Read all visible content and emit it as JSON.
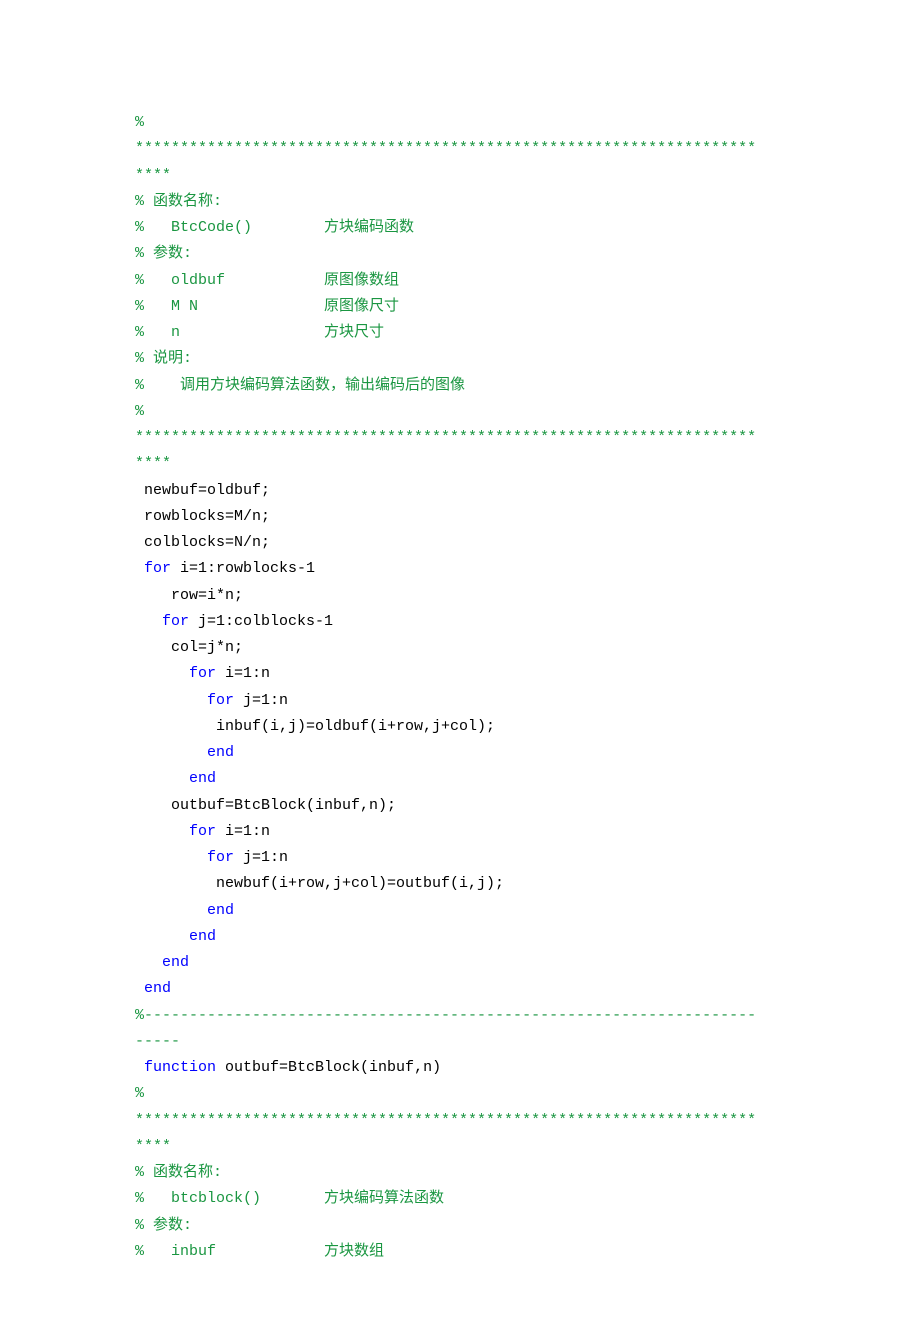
{
  "lines": [
    [
      {
        "cls": "cmt",
        "t": "%"
      }
    ],
    [
      {
        "cls": "cmt",
        "t": "*********************************************************************"
      }
    ],
    [
      {
        "cls": "cmt",
        "t": "****"
      }
    ],
    [
      {
        "cls": "cmt",
        "t": "% 函数名称:"
      }
    ],
    [
      {
        "cls": "cmt",
        "t": "%   BtcCode()        方块编码函数"
      }
    ],
    [
      {
        "cls": "cmt",
        "t": "% 参数:"
      }
    ],
    [
      {
        "cls": "cmt",
        "t": "%   oldbuf           原图像数组"
      }
    ],
    [
      {
        "cls": "cmt",
        "t": "%   M N              原图像尺寸"
      }
    ],
    [
      {
        "cls": "cmt",
        "t": "%   n                方块尺寸"
      }
    ],
    [
      {
        "cls": "cmt",
        "t": "% 说明:"
      }
    ],
    [
      {
        "cls": "cmt",
        "t": "%    调用方块编码算法函数，输出编码后的图像"
      }
    ],
    [
      {
        "cls": "cmt",
        "t": "%"
      }
    ],
    [
      {
        "cls": "cmt",
        "t": "*********************************************************************"
      }
    ],
    [
      {
        "cls": "cmt",
        "t": "****"
      }
    ],
    [
      {
        "cls": "txt",
        "t": " newbuf=oldbuf;"
      }
    ],
    [
      {
        "cls": "txt",
        "t": " rowblocks=M/n;"
      }
    ],
    [
      {
        "cls": "txt",
        "t": " colblocks=N/n;"
      }
    ],
    [
      {
        "cls": "txt",
        "t": " "
      },
      {
        "cls": "kw",
        "t": "for"
      },
      {
        "cls": "txt",
        "t": " i=1:rowblocks-1"
      }
    ],
    [
      {
        "cls": "txt",
        "t": "    row=i*n;"
      }
    ],
    [
      {
        "cls": "txt",
        "t": "   "
      },
      {
        "cls": "kw",
        "t": "for"
      },
      {
        "cls": "txt",
        "t": " j=1:colblocks-1"
      }
    ],
    [
      {
        "cls": "txt",
        "t": "    col=j*n;"
      }
    ],
    [
      {
        "cls": "txt",
        "t": "      "
      },
      {
        "cls": "kw",
        "t": "for"
      },
      {
        "cls": "txt",
        "t": " i=1:n"
      }
    ],
    [
      {
        "cls": "txt",
        "t": "        "
      },
      {
        "cls": "kw",
        "t": "for"
      },
      {
        "cls": "txt",
        "t": " j=1:n"
      }
    ],
    [
      {
        "cls": "txt",
        "t": "         inbuf(i,j)=oldbuf(i+row,j+col);"
      }
    ],
    [
      {
        "cls": "txt",
        "t": "        "
      },
      {
        "cls": "kw",
        "t": "end"
      }
    ],
    [
      {
        "cls": "txt",
        "t": "      "
      },
      {
        "cls": "kw",
        "t": "end"
      }
    ],
    [
      {
        "cls": "txt",
        "t": "    outbuf=BtcBlock(inbuf,n);"
      }
    ],
    [
      {
        "cls": "txt",
        "t": "      "
      },
      {
        "cls": "kw",
        "t": "for"
      },
      {
        "cls": "txt",
        "t": " i=1:n"
      }
    ],
    [
      {
        "cls": "txt",
        "t": "        "
      },
      {
        "cls": "kw",
        "t": "for"
      },
      {
        "cls": "txt",
        "t": " j=1:n"
      }
    ],
    [
      {
        "cls": "txt",
        "t": "         newbuf(i+row,j+col)=outbuf(i,j);"
      }
    ],
    [
      {
        "cls": "txt",
        "t": "        "
      },
      {
        "cls": "kw",
        "t": "end"
      }
    ],
    [
      {
        "cls": "txt",
        "t": "      "
      },
      {
        "cls": "kw",
        "t": "end"
      }
    ],
    [
      {
        "cls": "txt",
        "t": "   "
      },
      {
        "cls": "kw",
        "t": "end"
      }
    ],
    [
      {
        "cls": "txt",
        "t": " "
      },
      {
        "cls": "kw",
        "t": "end"
      }
    ],
    [
      {
        "cls": "cmt",
        "t": "%--------------------------------------------------------------------"
      }
    ],
    [
      {
        "cls": "cmt",
        "t": "-----"
      }
    ],
    [
      {
        "cls": "txt",
        "t": " "
      },
      {
        "cls": "kw",
        "t": "function"
      },
      {
        "cls": "txt",
        "t": " outbuf=BtcBlock(inbuf,n)"
      }
    ],
    [
      {
        "cls": "cmt",
        "t": "%"
      }
    ],
    [
      {
        "cls": "cmt",
        "t": "*********************************************************************"
      }
    ],
    [
      {
        "cls": "cmt",
        "t": "****"
      }
    ],
    [
      {
        "cls": "cmt",
        "t": "% 函数名称:"
      }
    ],
    [
      {
        "cls": "cmt",
        "t": "%   btcblock()       方块编码算法函数"
      }
    ],
    [
      {
        "cls": "cmt",
        "t": "% 参数:"
      }
    ],
    [
      {
        "cls": "cmt",
        "t": "%   inbuf            方块数组"
      }
    ]
  ]
}
